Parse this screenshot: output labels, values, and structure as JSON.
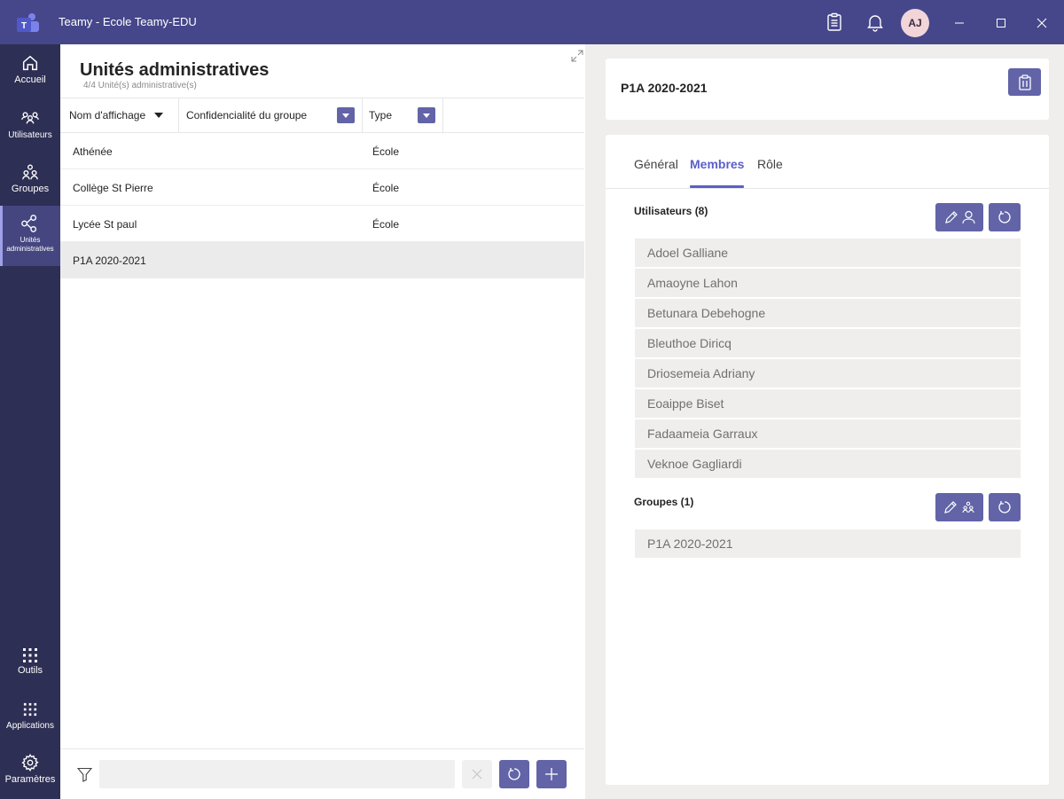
{
  "window": {
    "title": "Teamy - Ecole Teamy-EDU",
    "avatar_initials": "AJ"
  },
  "rail": {
    "items": [
      {
        "label": "Accueil",
        "icon": "home-icon"
      },
      {
        "label": "Utilisateurs",
        "icon": "users-icon"
      },
      {
        "label": "Groupes",
        "icon": "groups-icon"
      },
      {
        "label": "Unités administratives",
        "icon": "admin-units-icon"
      },
      {
        "label": "Outils",
        "icon": "grid-icon"
      },
      {
        "label": "Applications",
        "icon": "grid-icon"
      },
      {
        "label": "Paramètres",
        "icon": "gear-icon"
      }
    ]
  },
  "list_panel": {
    "title": "Unités administratives",
    "subtitle": "4/4 Unité(s) administrative(s)",
    "columns": [
      "Nom d'affichage",
      "Confidencialité du groupe",
      "Type"
    ],
    "rows": [
      {
        "name": "Athénée",
        "privacy": "",
        "type": "École"
      },
      {
        "name": "Collège St Pierre",
        "privacy": "",
        "type": "École"
      },
      {
        "name": "Lycée St paul",
        "privacy": "",
        "type": "École"
      },
      {
        "name": "P1A 2020-2021",
        "privacy": "",
        "type": ""
      }
    ],
    "selected_row": "P1A 2020-2021",
    "filter_value": ""
  },
  "detail": {
    "title": "P1A 2020-2021",
    "tabs": [
      "Général",
      "Membres",
      "Rôle"
    ],
    "active_tab": "Membres",
    "users_section": {
      "label": "Utilisateurs (8)",
      "items": [
        "Adoel Galliane",
        "Amaoyne Lahon",
        "Betunara Debehogne",
        "Bleuthoe Diricq",
        "Driosemeia Adriany",
        "Eoaippe Biset",
        "Fadaameia Garraux",
        "Veknoe Gagliardi"
      ]
    },
    "groups_section": {
      "label": "Groupes (1)",
      "items": [
        "P1A 2020-2021"
      ]
    }
  },
  "colors": {
    "titlebar": "#46478a",
    "rail": "#2e2f54",
    "accent": "#6264a7",
    "active_tab": "#5b5fc7"
  }
}
